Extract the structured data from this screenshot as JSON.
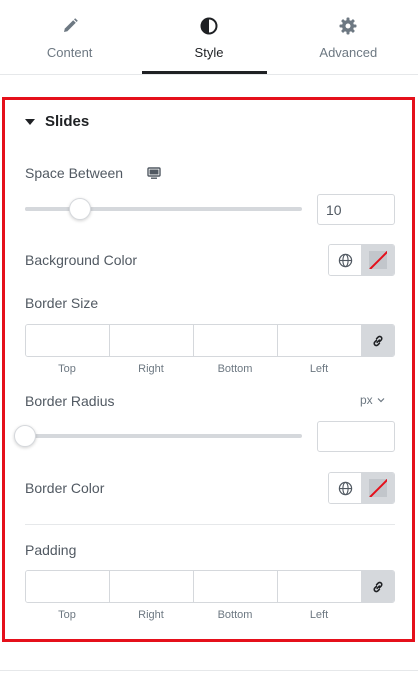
{
  "tabs": [
    {
      "label": "Content",
      "icon": "pencil-icon",
      "active": false
    },
    {
      "label": "Style",
      "icon": "half-circle-icon",
      "active": true
    },
    {
      "label": "Advanced",
      "icon": "gear-icon",
      "active": false
    }
  ],
  "section": {
    "title": "Slides",
    "expanded": true
  },
  "space_between": {
    "label": "Space Between",
    "icon": "desktop-icon",
    "value": "10",
    "slider_fraction": 0.2
  },
  "background_color": {
    "label": "Background Color",
    "global_icon": "globe-icon",
    "value": "none"
  },
  "border_size": {
    "label": "Border Size",
    "fields": [
      {
        "label": "Top",
        "value": ""
      },
      {
        "label": "Right",
        "value": ""
      },
      {
        "label": "Bottom",
        "value": ""
      },
      {
        "label": "Left",
        "value": ""
      }
    ],
    "link_icon": "link-icon"
  },
  "border_radius": {
    "label": "Border Radius",
    "unit": "px",
    "value": "",
    "slider_fraction": 0
  },
  "border_color": {
    "label": "Border Color",
    "global_icon": "globe-icon",
    "value": "none"
  },
  "padding": {
    "label": "Padding",
    "fields": [
      {
        "label": "Top",
        "value": ""
      },
      {
        "label": "Right",
        "value": ""
      },
      {
        "label": "Bottom",
        "value": ""
      },
      {
        "label": "Left",
        "value": ""
      }
    ],
    "link_icon": "link-icon"
  },
  "colors": {
    "highlight": "#e5101b",
    "active_text": "#1f2124",
    "label_text": "#515962",
    "border": "#d5d8dc"
  }
}
